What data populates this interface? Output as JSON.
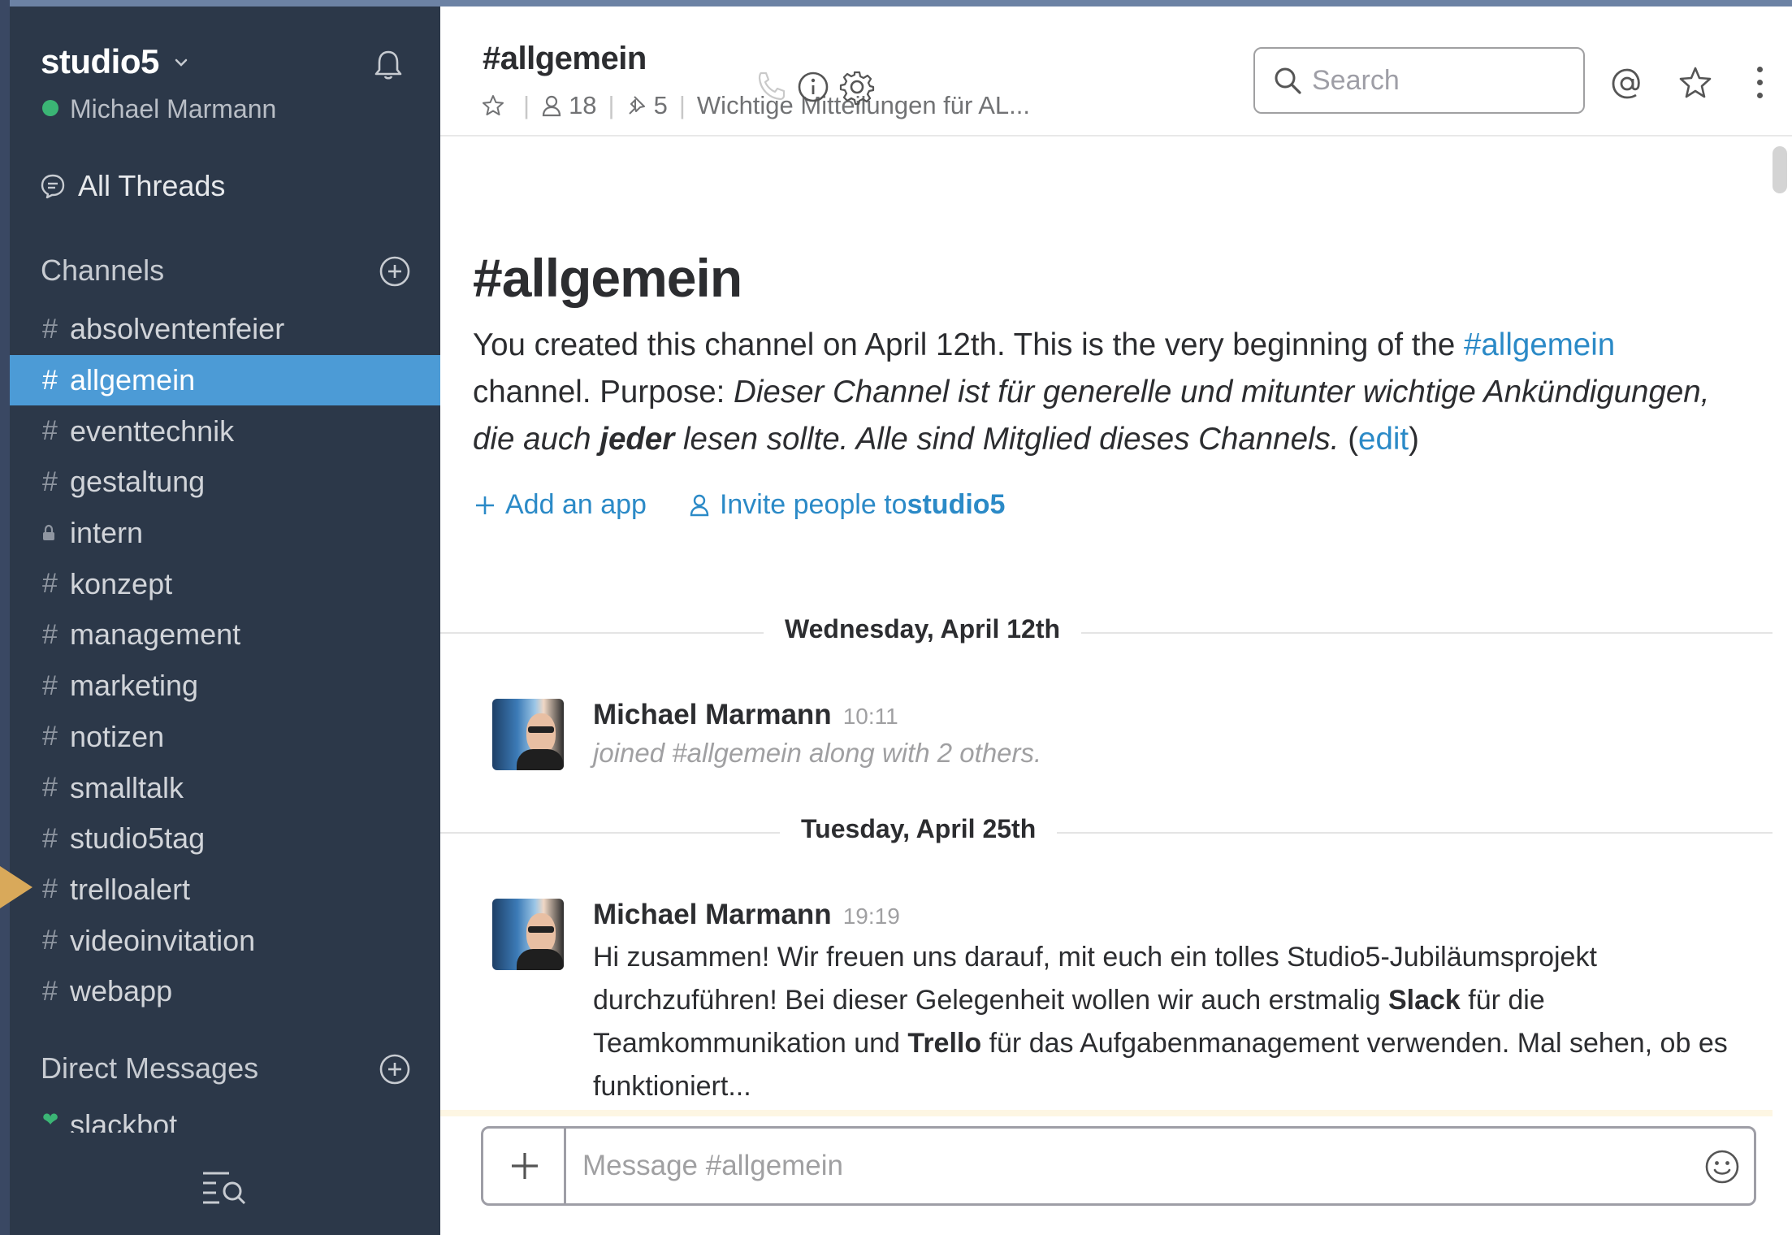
{
  "sidebar": {
    "team_name": "studio5",
    "user_name": "Michael Marmann",
    "all_threads": "All Threads",
    "channels_heading": "Channels",
    "channels": [
      {
        "label": "absolventenfeier",
        "type": "public"
      },
      {
        "label": "allgemein",
        "type": "public",
        "active": true
      },
      {
        "label": "eventtechnik",
        "type": "public"
      },
      {
        "label": "gestaltung",
        "type": "public"
      },
      {
        "label": "intern",
        "type": "private"
      },
      {
        "label": "konzept",
        "type": "public"
      },
      {
        "label": "management",
        "type": "public"
      },
      {
        "label": "marketing",
        "type": "public"
      },
      {
        "label": "notizen",
        "type": "public"
      },
      {
        "label": "smalltalk",
        "type": "public"
      },
      {
        "label": "studio5tag",
        "type": "public"
      },
      {
        "label": "trelloalert",
        "type": "public"
      },
      {
        "label": "videoinvitation",
        "type": "public"
      },
      {
        "label": "webapp",
        "type": "public"
      }
    ],
    "channel_prefix": "#",
    "dm_heading": "Direct Messages",
    "dms": [
      {
        "label": "slackbot"
      }
    ]
  },
  "header": {
    "channel_name": "#allgemein",
    "member_count": "18",
    "pinned_count": "5",
    "topic": "Wichtige Mitteilungen für AL...",
    "search_placeholder": "Search"
  },
  "intro": {
    "title": "#allgemein",
    "line1": "You created this channel on April 12th. This is the very beginning of the",
    "channel_link": "#allgemein",
    "purpose_prefix": " channel. Purpose: ",
    "purpose_part1": "Dieser Channel ist für generelle und mitunter wichtige Ankündigungen, die auch ",
    "purpose_bold": "jeder",
    "purpose_part2": " lesen sollte. Alle sind Mitglied dieses Channels.",
    "edit_open": " (",
    "edit_link": "edit",
    "edit_close": ")",
    "add_app": "Add an app",
    "invite_prefix": "Invite people to ",
    "invite_team": "studio5"
  },
  "messages": {
    "day1": "Wednesday, April 12th",
    "msg1": {
      "author": "Michael Marmann",
      "time": "10:11",
      "text": "joined #allgemein along with 2 others."
    },
    "day2": "Tuesday, April 25th",
    "msg2": {
      "author": "Michael Marmann",
      "time": "19:19",
      "text_a": "Hi zusammen! Wir freuen uns darauf, mit euch ein tolles Studio5-Jubiläumsprojekt durchzuführen! Bei dieser Gelegenheit wollen wir auch erstmalig ",
      "bold_1": "Slack",
      "text_b": " für die Teamkommunikation und ",
      "bold_2": "Trello",
      "text_c": " für das Aufgabenmanagement verwenden. Mal sehen, ob es funktioniert..."
    }
  },
  "composer": {
    "placeholder": "Message #allgemein"
  },
  "colors": {
    "sidebar_bg": "#2c3849",
    "active_channel": "#4c9bd6",
    "link": "#2b8ac7",
    "presence": "#3bb575"
  }
}
